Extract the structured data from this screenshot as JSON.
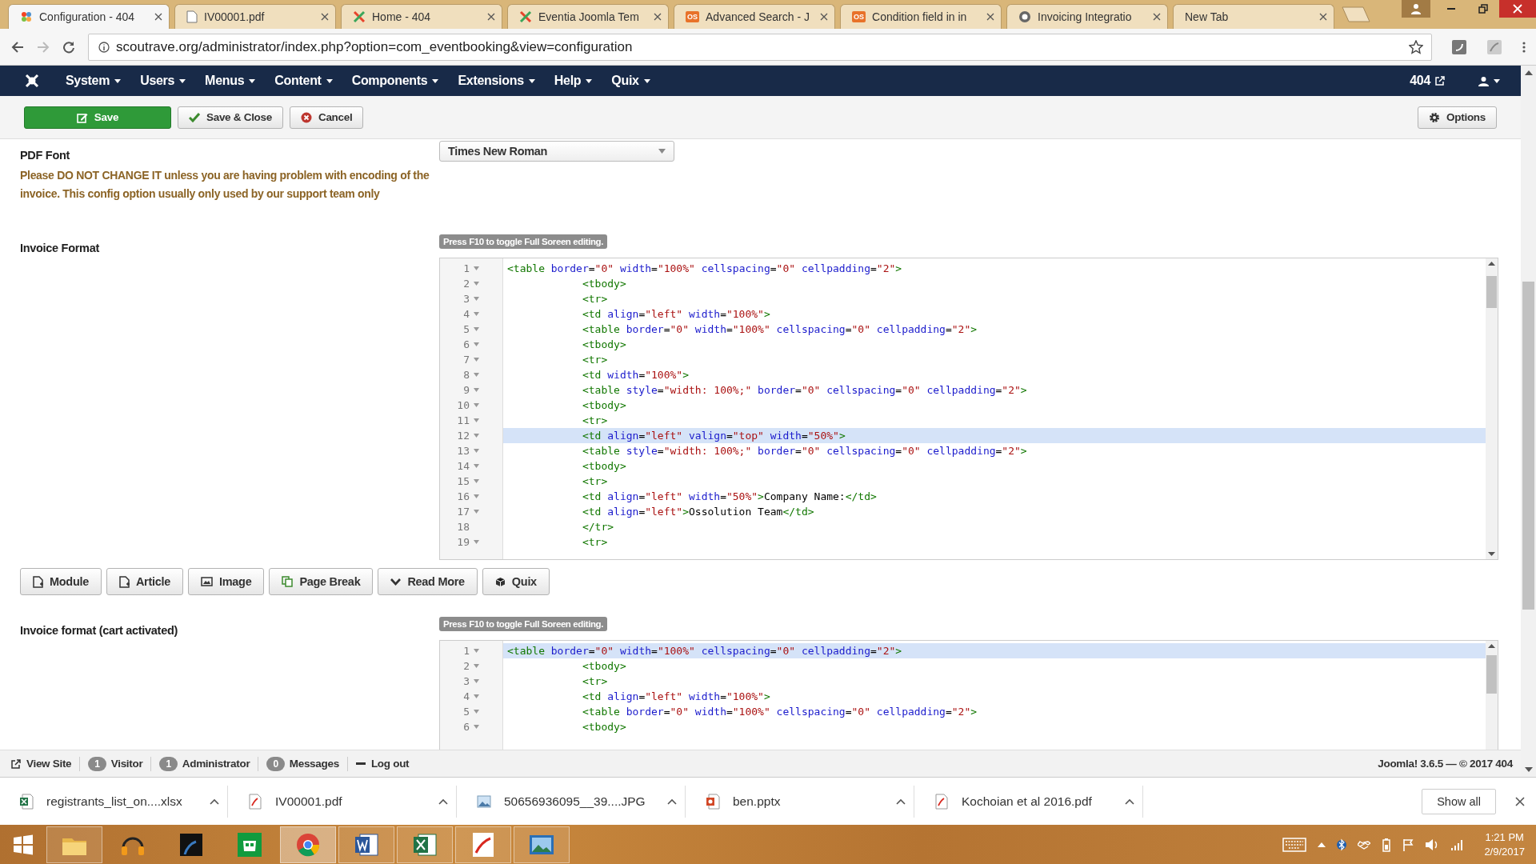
{
  "browser": {
    "tabs": [
      {
        "title": "Configuration - 404",
        "kind": "joomla",
        "selected": true
      },
      {
        "title": "IV00001.pdf",
        "kind": "document",
        "selected": false
      },
      {
        "title": "Home - 404",
        "kind": "cross",
        "selected": false
      },
      {
        "title": "Eventia Joomla Tem",
        "kind": "cross",
        "selected": false
      },
      {
        "title": "Advanced Search - J",
        "kind": "badge",
        "badge": "OS",
        "selected": false
      },
      {
        "title": "Condition field in in",
        "kind": "badge",
        "badge": "OS",
        "selected": false
      },
      {
        "title": "Invoicing Integratio",
        "kind": "circle",
        "selected": false
      },
      {
        "title": "New Tab",
        "kind": "plain",
        "selected": false
      }
    ],
    "address": "scoutrave.org/administrator/index.php?option=com_eventbooking&view=configuration"
  },
  "nav": {
    "menus": [
      "System",
      "Users",
      "Menus",
      "Content",
      "Components",
      "Extensions",
      "Help",
      "Quix"
    ],
    "site": "404"
  },
  "toolbar": {
    "buttons": [
      {
        "label": "Save",
        "kind": "save"
      },
      {
        "label": "Save & Close",
        "kind": "check"
      },
      {
        "label": "Cancel",
        "kind": "cancel"
      }
    ],
    "options": "Options"
  },
  "pdf_font": {
    "label": "PDF Font",
    "value": "Times New Roman",
    "description": "Please DO NOT CHANGE IT unless you are having problem with encoding of the invoice. This config option usually only used by our support team only"
  },
  "invoice_format": {
    "label": "Invoice Format",
    "hint": "Press F10 to toggle Full Soreen editing.",
    "lines": [
      {
        "number": "1",
        "fold": true,
        "highlighted": false,
        "text": "<table border=\"0\" width=\"100%\" cellspacing=\"0\" cellpadding=\"2\">"
      },
      {
        "number": "2",
        "fold": true,
        "highlighted": false,
        "text": "            <tbody>"
      },
      {
        "number": "3",
        "fold": true,
        "highlighted": false,
        "text": "            <tr>"
      },
      {
        "number": "4",
        "fold": true,
        "highlighted": false,
        "text": "            <td align=\"left\" width=\"100%\">"
      },
      {
        "number": "5",
        "fold": true,
        "highlighted": false,
        "text": "            <table border=\"0\" width=\"100%\" cellspacing=\"0\" cellpadding=\"2\">"
      },
      {
        "number": "6",
        "fold": true,
        "highlighted": false,
        "text": "            <tbody>"
      },
      {
        "number": "7",
        "fold": true,
        "highlighted": false,
        "text": "            <tr>"
      },
      {
        "number": "8",
        "fold": true,
        "highlighted": false,
        "text": "            <td width=\"100%\">"
      },
      {
        "number": "9",
        "fold": true,
        "highlighted": false,
        "text": "            <table style=\"width: 100%;\" border=\"0\" cellspacing=\"0\" cellpadding=\"2\">"
      },
      {
        "number": "10",
        "fold": true,
        "highlighted": false,
        "text": "            <tbody>"
      },
      {
        "number": "11",
        "fold": true,
        "highlighted": false,
        "text": "            <tr>"
      },
      {
        "number": "12",
        "fold": true,
        "highlighted": true,
        "text": "            <td align=\"left\" valign=\"top\" width=\"50%\">"
      },
      {
        "number": "13",
        "fold": true,
        "highlighted": false,
        "text": "            <table style=\"width: 100%;\" border=\"0\" cellspacing=\"0\" cellpadding=\"2\">"
      },
      {
        "number": "14",
        "fold": true,
        "highlighted": false,
        "text": "            <tbody>"
      },
      {
        "number": "15",
        "fold": true,
        "highlighted": false,
        "text": "            <tr>"
      },
      {
        "number": "16",
        "fold": true,
        "highlighted": false,
        "text": "            <td align=\"left\" width=\"50%\">Company Name:</td>"
      },
      {
        "number": "17",
        "fold": true,
        "highlighted": false,
        "text": "            <td align=\"left\">Ossolution Team</td>"
      },
      {
        "number": "18",
        "fold": false,
        "highlighted": false,
        "text": "            </tr>"
      },
      {
        "number": "19",
        "fold": true,
        "highlighted": false,
        "text": "            <tr>"
      }
    ]
  },
  "editor_buttons": [
    {
      "label": "Module",
      "kind": "file-plus"
    },
    {
      "label": "Article",
      "kind": "file-plus"
    },
    {
      "label": "Image",
      "kind": "image"
    },
    {
      "label": "Page Break",
      "kind": "copy"
    },
    {
      "label": "Read More",
      "kind": "chevron"
    },
    {
      "label": "Quix",
      "kind": "cube"
    }
  ],
  "invoice_format_cart": {
    "label": "Invoice format (cart activated)",
    "hint": "Press F10 to toggle Full Soreen editing.",
    "lines": [
      {
        "number": "1",
        "fold": true,
        "highlighted": true,
        "text": "<table border=\"0\" width=\"100%\" cellspacing=\"0\" cellpadding=\"2\">"
      },
      {
        "number": "2",
        "fold": true,
        "highlighted": false,
        "text": "            <tbody>"
      },
      {
        "number": "3",
        "fold": true,
        "highlighted": false,
        "text": "            <tr>"
      },
      {
        "number": "4",
        "fold": true,
        "highlighted": false,
        "text": "            <td align=\"left\" width=\"100%\">"
      },
      {
        "number": "5",
        "fold": true,
        "highlighted": false,
        "text": "            <table border=\"0\" width=\"100%\" cellspacing=\"0\" cellpadding=\"2\">"
      },
      {
        "number": "6",
        "fold": true,
        "highlighted": false,
        "text": "            <tbody>"
      }
    ]
  },
  "status_bar": {
    "view_site": "View Site",
    "counters": [
      {
        "count": "1",
        "label": "Visitor"
      },
      {
        "count": "1",
        "label": "Administrator"
      },
      {
        "count": "0",
        "label": "Messages"
      }
    ],
    "logout": "Log out",
    "version": "Joomla! 3.6.5 — © 2017 404"
  },
  "downloads": {
    "items": [
      {
        "name": "registrants_list_on....xlsx",
        "kind": "sheet"
      },
      {
        "name": "IV00001.pdf",
        "kind": "pdf"
      },
      {
        "name": "50656936095__39....JPG",
        "kind": "image"
      },
      {
        "name": "ben.pptx",
        "kind": "slides"
      },
      {
        "name": "Kochoian et al 2016.pdf",
        "kind": "pdf"
      }
    ],
    "show_all": "Show all"
  },
  "taskbar": {
    "apps": [
      {
        "kind": "folder",
        "running": true,
        "selected": false
      },
      {
        "kind": "headphones",
        "running": false,
        "selected": false
      },
      {
        "kind": "reader",
        "running": false,
        "selected": false
      },
      {
        "kind": "store",
        "running": false,
        "selected": false
      },
      {
        "kind": "browser",
        "running": true,
        "selected": true
      },
      {
        "kind": "document",
        "running": true,
        "selected": false
      },
      {
        "kind": "spreadsheet",
        "running": true,
        "selected": false
      },
      {
        "kind": "pdf",
        "running": true,
        "selected": false
      },
      {
        "kind": "photo",
        "running": true,
        "selected": false
      }
    ],
    "time": "1:21 PM",
    "date": "2/9/2017"
  }
}
